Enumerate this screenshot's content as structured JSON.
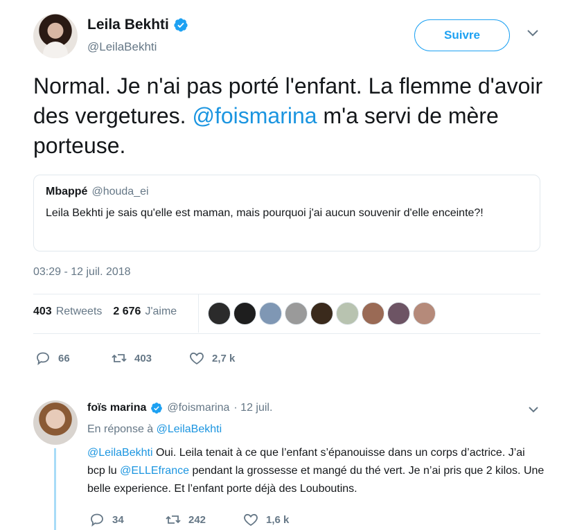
{
  "author": {
    "name": "Leila Bekhti",
    "handle": "@LeilaBekhti",
    "follow_label": "Suivre"
  },
  "tweet": {
    "text_part1": "Normal. Je n'ai pas porté l'enfant. La flemme d'avoir des vergetures. ",
    "mention": "@foismarina",
    "text_part2": " m'a servi de mère porteuse.",
    "timestamp": "03:29 - 12 juil. 2018"
  },
  "quoted": {
    "name": "Mbappé",
    "handle": "@houda_ei",
    "text": "Leila Bekhti je sais qu'elle est maman, mais pourquoi j'ai aucun souvenir d'elle enceinte?!"
  },
  "stats": {
    "retweets_count": "403",
    "retweets_label": "Retweets",
    "likes_count": "2 676",
    "likes_label": "J'aime"
  },
  "likers": [
    "#2b2b2b",
    "#1e1e1e",
    "#7f97b4",
    "#9a9a9a",
    "#3a2a1c",
    "#b8c3b0",
    "#9a6a55",
    "#6d5464",
    "#b58a7a"
  ],
  "actions": {
    "replies": "66",
    "retweets": "403",
    "likes": "2,7 k"
  },
  "reply": {
    "name": "foïs marina",
    "handle": "@foismarina",
    "date": "· 12 juil.",
    "replying_prefix": "En réponse à ",
    "replying_to": "@LeilaBekhti",
    "mention1": "@LeilaBekhti",
    "text1": " Oui. Leila tenait à ce que l’enfant s’épanouisse dans un corps d’actrice. J’ai bcp lu ",
    "mention2": "@ELLEfrance",
    "text2": " pendant la grossesse et mangé du thé vert. Je n’ai pris que 2 kilos. Une belle experience. Et l’enfant porte déjà des Louboutins.",
    "replies": "34",
    "retweets": "242",
    "likes": "1,6 k"
  },
  "colors": {
    "accent": "#1da1f2",
    "link": "#1b95e0",
    "muted": "#657786",
    "thread": "#a8dcf7"
  }
}
